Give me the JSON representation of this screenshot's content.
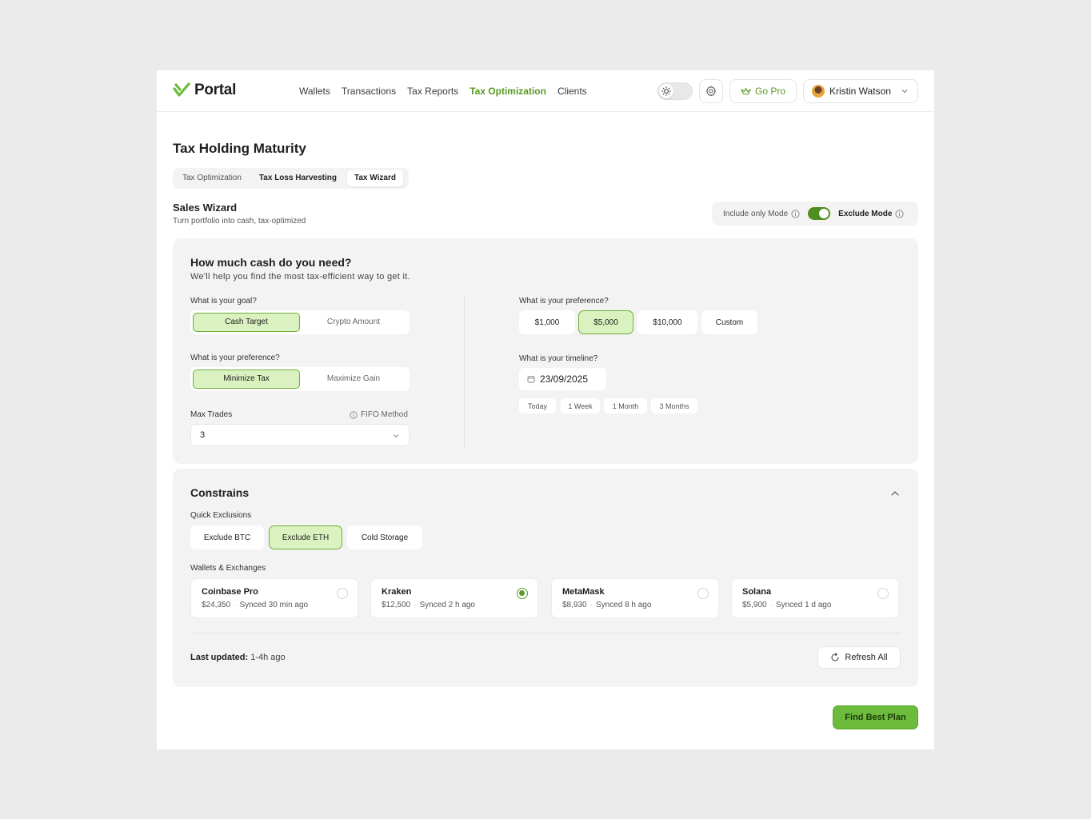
{
  "brand": {
    "name": "Portal",
    "accent": "#5a9a24"
  },
  "nav": {
    "items": [
      {
        "label": "Wallets",
        "active": false
      },
      {
        "label": "Transactions",
        "active": false
      },
      {
        "label": "Tax Reports",
        "active": false
      },
      {
        "label": "Tax Optimization",
        "active": true
      },
      {
        "label": "Clients",
        "active": false
      }
    ]
  },
  "header": {
    "go_pro": "Go Pro",
    "user_name": "Kristin Watson"
  },
  "page": {
    "title": "Tax Holding Maturity",
    "subtabs": [
      "Tax Optimization",
      "Tax Loss Harvesting",
      "Tax Wizard"
    ]
  },
  "wizard": {
    "title": "Sales Wizard",
    "subtitle": "Turn portfolio into cash, tax-optimized",
    "mode_include": "Include only Mode",
    "mode_exclude": "Exclude Mode"
  },
  "cash": {
    "title": "How much cash do you need?",
    "subtitle": "We'll help you find the most tax-efficient way to get it.",
    "goal_label": "What is your goal?",
    "goal_options": [
      "Cash Target",
      "Crypto Amount"
    ],
    "pref_label": "What is your preference?",
    "pref_options": [
      "Minimize Tax",
      "Maximize Gain"
    ],
    "max_trades_label": "Max Trades",
    "fifo_label": "FIFO Method",
    "max_trades_value": "3",
    "amount_label": "What is your preference?",
    "amounts": [
      "$1,000",
      "$5,000",
      "$10,000",
      "Custom"
    ],
    "timeline_label": "What is your timeline?",
    "date": "23/09/2025",
    "quick_dates": [
      "Today",
      "1 Week",
      "1 Month",
      "3 Months"
    ]
  },
  "constraints": {
    "title": "Constrains",
    "quick_label": "Quick Exclusions",
    "quick": [
      "Exclude BTC",
      "Exclude ETH",
      "Cold Storage"
    ],
    "wallets_label": "Wallets & Exchanges",
    "wallets": [
      {
        "name": "Coinbase Pro",
        "amount": "$24,350",
        "synced": "Synced 30 min ago"
      },
      {
        "name": "Kraken",
        "amount": "$12,500",
        "synced": "Synced 2 h ago"
      },
      {
        "name": "MetaMask",
        "amount": "$8,930",
        "synced": "Synced 8 h ago"
      },
      {
        "name": "Solana",
        "amount": "$5,900",
        "synced": "Synced 1 d ago"
      }
    ],
    "last_updated_label": "Last updated:",
    "last_updated_value": "1-4h ago",
    "refresh": "Refresh All"
  },
  "cta": "Find Best Plan"
}
